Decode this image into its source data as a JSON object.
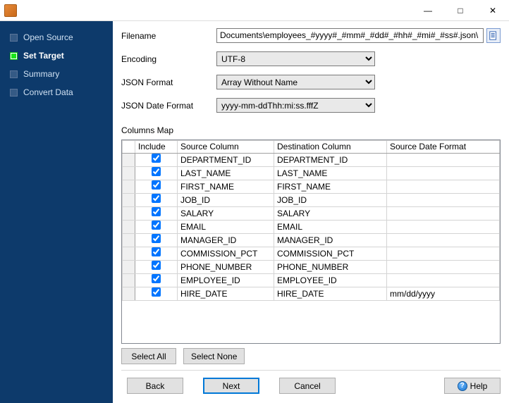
{
  "labels": {
    "filename": "Filename",
    "encoding": "Encoding",
    "json_format": "JSON Format",
    "json_date_format": "JSON Date Format",
    "columns_map": "Columns Map"
  },
  "sidebar": {
    "items": [
      {
        "label": "Open Source",
        "current": false
      },
      {
        "label": "Set Target",
        "current": true
      },
      {
        "label": "Summary",
        "current": false
      },
      {
        "label": "Convert Data",
        "current": false
      }
    ]
  },
  "fields": {
    "filename": "\\Documents\\employees_#yyyy#_#mm#_#dd#_#hh#_#mi#_#ss#.json",
    "encoding": "UTF-8",
    "json_format": "Array Without Name",
    "json_date_format": "yyyy-mm-ddThh:mi:ss.fffZ"
  },
  "table": {
    "headers": {
      "include": "Include",
      "source": "Source Column",
      "dest": "Destination Column",
      "srcfmt": "Source Date Format"
    },
    "rows": [
      {
        "include": true,
        "source": "DEPARTMENT_ID",
        "dest": "DEPARTMENT_ID",
        "srcfmt": ""
      },
      {
        "include": true,
        "source": "LAST_NAME",
        "dest": "LAST_NAME",
        "srcfmt": ""
      },
      {
        "include": true,
        "source": "FIRST_NAME",
        "dest": "FIRST_NAME",
        "srcfmt": ""
      },
      {
        "include": true,
        "source": "JOB_ID",
        "dest": "JOB_ID",
        "srcfmt": ""
      },
      {
        "include": true,
        "source": "SALARY",
        "dest": "SALARY",
        "srcfmt": ""
      },
      {
        "include": true,
        "source": "EMAIL",
        "dest": "EMAIL",
        "srcfmt": ""
      },
      {
        "include": true,
        "source": "MANAGER_ID",
        "dest": "MANAGER_ID",
        "srcfmt": ""
      },
      {
        "include": true,
        "source": "COMMISSION_PCT",
        "dest": "COMMISSION_PCT",
        "srcfmt": ""
      },
      {
        "include": true,
        "source": "PHONE_NUMBER",
        "dest": "PHONE_NUMBER",
        "srcfmt": ""
      },
      {
        "include": true,
        "source": "EMPLOYEE_ID",
        "dest": "EMPLOYEE_ID",
        "srcfmt": ""
      },
      {
        "include": true,
        "source": "HIRE_DATE",
        "dest": "HIRE_DATE",
        "srcfmt": "mm/dd/yyyy"
      }
    ]
  },
  "buttons": {
    "select_all": "Select All",
    "select_none": "Select None",
    "back": "Back",
    "next": "Next",
    "cancel": "Cancel",
    "help": "Help"
  }
}
